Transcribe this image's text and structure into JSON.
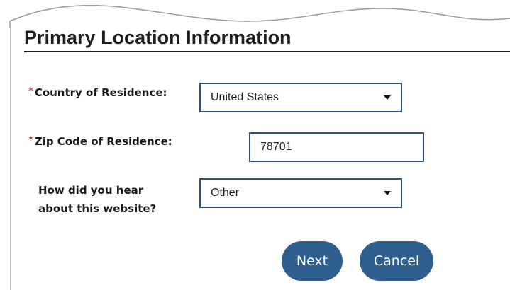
{
  "page": {
    "title": "Primary Location Information"
  },
  "form": {
    "required_marker": "*",
    "country": {
      "label": "Country of Residence:",
      "required": true,
      "value": "United States"
    },
    "zip": {
      "label": "Zip Code of Residence:",
      "required": true,
      "value": "78701"
    },
    "referral": {
      "label_line1": "How did you hear",
      "label_line2": "about this website?",
      "required": false,
      "value": "Other"
    }
  },
  "actions": {
    "next_label": "Next",
    "cancel_label": "Cancel"
  },
  "colors": {
    "accent": "#2f5f8f",
    "field_border": "#2c5282",
    "required": "#c0392b"
  }
}
